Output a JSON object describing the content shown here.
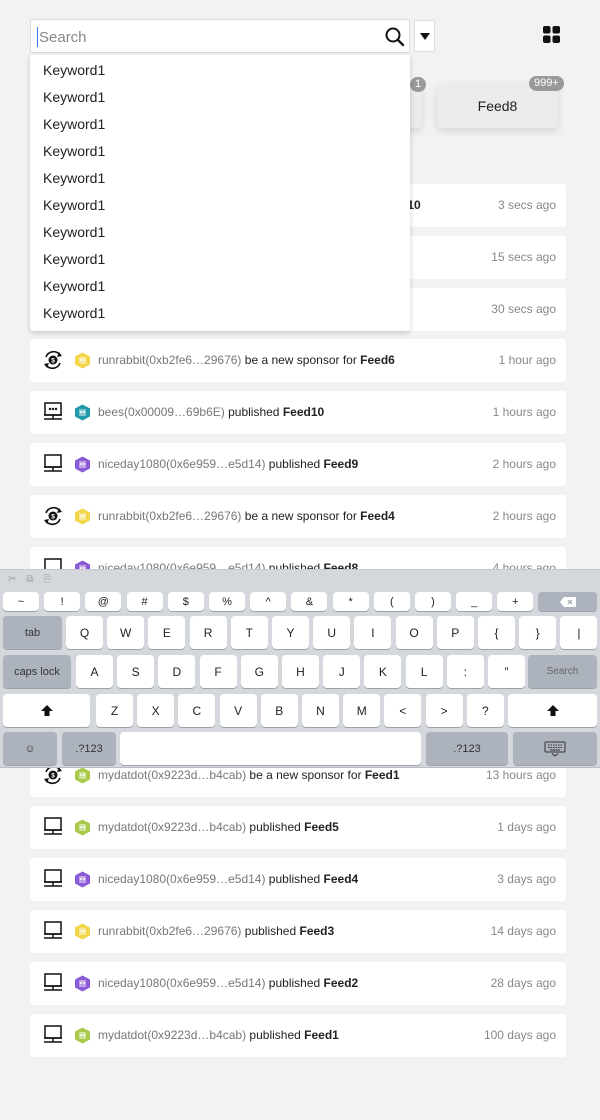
{
  "search": {
    "placeholder": "Search",
    "suggestions": [
      "Keyword1",
      "Keyword1",
      "Keyword1",
      "Keyword1",
      "Keyword1",
      "Keyword1",
      "Keyword1",
      "Keyword1",
      "Keyword1",
      "Keyword1"
    ]
  },
  "feeds": {
    "partial_badge": "1",
    "tab_label": "Feed8",
    "tab_badge": "999+"
  },
  "activity": [
    {
      "type": "",
      "user": "",
      "action": "",
      "feed": "l10",
      "time": "3 secs ago"
    },
    {
      "type": "",
      "user": "",
      "action": "",
      "feed": "",
      "time": "15 secs ago"
    },
    {
      "type": "",
      "user": "",
      "action": "",
      "feed": "",
      "time": "30 secs ago"
    },
    {
      "type": "sponsor",
      "avatar": "yellow",
      "user": "runrabbit(0xb2fe6…29676)",
      "action": " be a new sponsor for ",
      "feed": "Feed6",
      "time": "1 hour ago"
    },
    {
      "type": "publish-dots",
      "avatar": "teal",
      "user": "bees(0x00009…69b6E)",
      "action": " published ",
      "feed": "Feed10",
      "time": "1 hours ago"
    },
    {
      "type": "publish",
      "avatar": "purple",
      "user": "niceday1080(0x6e959…e5d14)",
      "action": " published ",
      "feed": "Feed9",
      "time": "2 hours ago"
    },
    {
      "type": "sponsor",
      "avatar": "yellow",
      "user": "runrabbit(0xb2fe6…29676)",
      "action": " be a new sponsor for ",
      "feed": "Feed4",
      "time": "2 hours ago"
    },
    {
      "type": "publish",
      "avatar": "purple",
      "user": "niceday1080(0x6e959…e5d14)",
      "action": " published ",
      "feed": "Feed8",
      "time": "4 hours ago"
    },
    {
      "type": "sponsor",
      "avatar": "green",
      "user": "mydatdot(0x9223d…b4cab)",
      "action": " be a new sponsor for ",
      "feed": "Feed1",
      "time": "13 hours ago"
    },
    {
      "type": "publish",
      "avatar": "green",
      "user": "mydatdot(0x9223d…b4cab)",
      "action": " published ",
      "feed": "Feed5",
      "time": "1 days ago"
    },
    {
      "type": "publish",
      "avatar": "purple",
      "user": "niceday1080(0x6e959…e5d14)",
      "action": " published ",
      "feed": "Feed4",
      "time": "3 days ago"
    },
    {
      "type": "publish",
      "avatar": "yellow",
      "user": "runrabbit(0xb2fe6…29676)",
      "action": " published ",
      "feed": "Feed3",
      "time": "14 days ago"
    },
    {
      "type": "publish",
      "avatar": "purple",
      "user": "niceday1080(0x6e959…e5d14)",
      "action": " published ",
      "feed": "Feed2",
      "time": "28 days ago"
    },
    {
      "type": "publish",
      "avatar": "green",
      "user": "mydatdot(0x9223d…b4cab)",
      "action": " published ",
      "feed": "Feed1",
      "time": "100 days ago"
    }
  ],
  "keyboard": {
    "row1": [
      "~",
      "!",
      "@",
      "#",
      "$",
      "%",
      "^",
      "&",
      "*",
      "(",
      ")",
      "_",
      "+"
    ],
    "row2": [
      "Q",
      "W",
      "E",
      "R",
      "T",
      "Y",
      "U",
      "I",
      "O",
      "P",
      "{",
      "}",
      "|"
    ],
    "row3": [
      "A",
      "S",
      "D",
      "F",
      "G",
      "H",
      "J",
      "K",
      "L",
      ":",
      "”"
    ],
    "row4": [
      "Z",
      "X",
      "C",
      "V",
      "B",
      "N",
      "M",
      "<",
      ">",
      "?"
    ],
    "tab": "tab",
    "caps": "caps lock",
    "search": "Search",
    "numbers": ".?123"
  },
  "colors": {
    "yellow": "#f2d649",
    "teal": "#1f9aa8",
    "purple": "#8a5bd6",
    "green": "#a8c94a"
  }
}
